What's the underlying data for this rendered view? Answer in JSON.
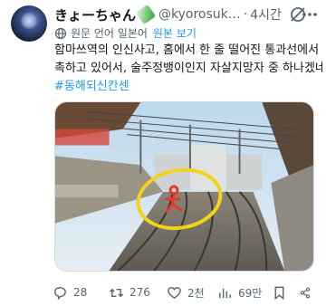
{
  "header": {
    "display_name": "きょーちゃん",
    "handle": "@kyorosuk…",
    "separator": "·",
    "time": "4시간"
  },
  "translation": {
    "label": "원문 언어 일본어",
    "show_original": "원본 보기"
  },
  "tweet": {
    "line1": "함마쓰역의 인신사고, 홈에서 한 줄 떨어진 통과선에서 접",
    "line2": "촉하고 있어서, 술주정뱅이인지 자살지망자 중 하나겠네.",
    "hashtag": "#동해되신칸센"
  },
  "media": {
    "annotation_color": "#f2d21b",
    "marker_color": "#e8362a"
  },
  "actions": {
    "reply_count": "28",
    "retweet_count": "276",
    "like_count": "2천",
    "view_count": "69만"
  }
}
